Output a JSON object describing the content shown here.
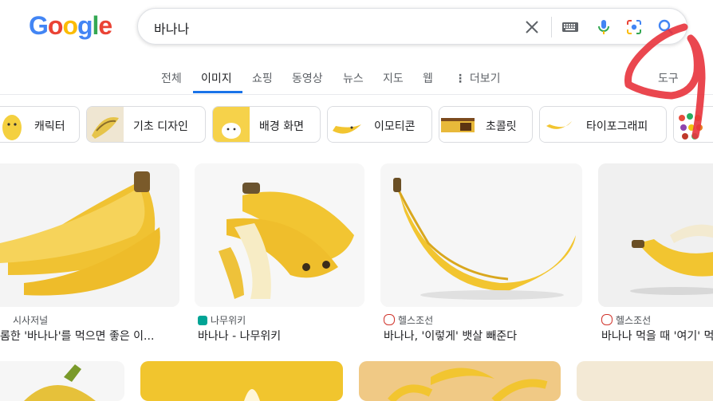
{
  "logo": [
    "G",
    "o",
    "o",
    "g",
    "l",
    "e"
  ],
  "search": {
    "query": "바나나",
    "icons": [
      "close-icon",
      "keyboard-icon",
      "mic-icon",
      "lens-icon",
      "search-icon"
    ]
  },
  "tabs": {
    "items": [
      "전체",
      "이미지",
      "쇼핑",
      "동영상",
      "뉴스",
      "지도",
      "웹"
    ],
    "more": "더보기",
    "tools": "도구",
    "active": "이미지"
  },
  "chips": [
    "캐릭터",
    "기초 디자인",
    "배경 화면",
    "이모티콘",
    "초콜릿",
    "타이포그래피"
  ],
  "results": [
    {
      "source": "시사저널",
      "title": "롬한 '바나나'를 먹으면 좋은 이..."
    },
    {
      "source": "나무위키",
      "title": "바나나 - 나무위키"
    },
    {
      "source": "헬스조선",
      "title": "바나나, '이렇게' 뱃살 빼준다"
    },
    {
      "source": "헬스조선",
      "title": "바나나 먹을 때 '여기' 먹"
    }
  ],
  "colors": {
    "accent": "#1a73e8",
    "annotation": "#e8333c",
    "banana": "#f2c530"
  }
}
